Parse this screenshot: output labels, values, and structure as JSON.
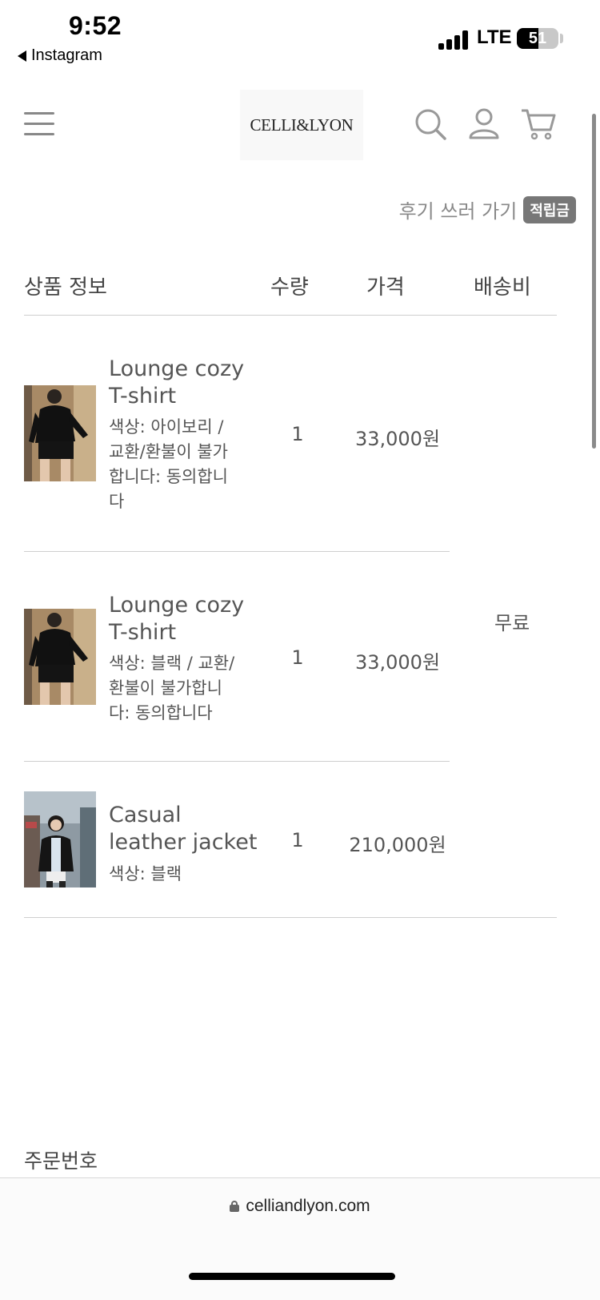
{
  "status_bar": {
    "time": "9:52",
    "back_app": "Instagram",
    "network": "LTE",
    "battery": "51",
    "battery_level": 0.51
  },
  "header": {
    "logo": "CELLI&LYON"
  },
  "review": {
    "link_label": "후기 쓰러 가기",
    "points_badge": "적립금"
  },
  "table": {
    "columns": [
      "상품 정보",
      "수량",
      "가격",
      "배송비"
    ],
    "rows": [
      {
        "name_line1": "Lounge cozy",
        "name_line2": "T-shirt",
        "options": [
          "색상: 아이보리 /",
          "교환/환불이 불가",
          "합니다: 동의합니",
          "다"
        ],
        "quantity": "1",
        "price": "33,000원"
      },
      {
        "name_line1": "Lounge cozy",
        "name_line2": "T-shirt",
        "options": [
          "색상: 블랙 / 교환/",
          "환불이 불가합니",
          "다: 동의합니다"
        ],
        "quantity": "1",
        "price": "33,000원"
      },
      {
        "name_line1": "Casual",
        "name_line2": "leather jacket",
        "options": [
          "색상: 블랙"
        ],
        "quantity": "1",
        "price": "210,000원"
      }
    ],
    "shipping": "무료"
  },
  "order": {
    "label": "주문번호"
  },
  "browser": {
    "url": "celliandlyon.com"
  }
}
